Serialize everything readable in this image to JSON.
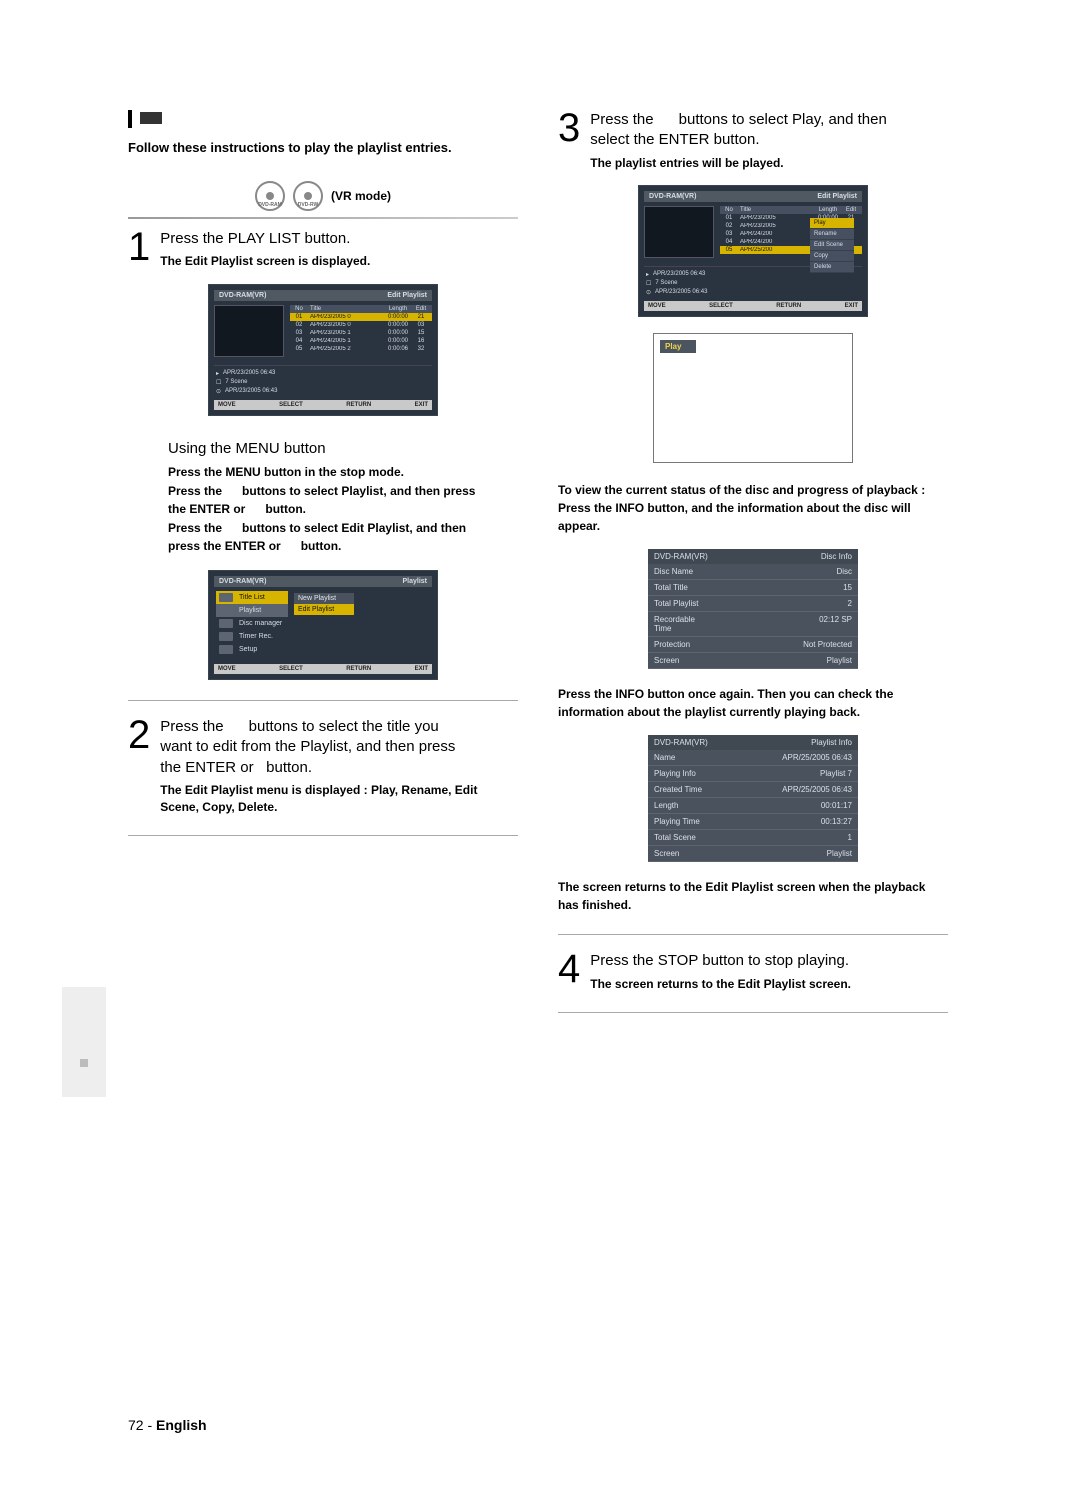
{
  "intro": "Follow these instructions to play the playlist entries.",
  "discs": {
    "d1": "DVD-RAM",
    "d2": "DVD-RW",
    "mode": "(VR mode)"
  },
  "step1": {
    "num": "1",
    "text": "Press the PLAY LIST button.",
    "sub": "The Edit Playlist screen is displayed."
  },
  "screen1": {
    "left": "DVD-RAM(VR)",
    "right": "Edit Playlist",
    "cols": {
      "no": "No",
      "title": "Title",
      "len": "Length",
      "edit": "Edit"
    },
    "rows": [
      {
        "n": "01",
        "t": "APR/23/2005 0",
        "l": "0:00:00",
        "e": "21"
      },
      {
        "n": "02",
        "t": "APR/23/2005 0",
        "l": "0:00:00",
        "e": "03"
      },
      {
        "n": "03",
        "t": "APR/23/2005 1",
        "l": "0:00:00",
        "e": "15"
      },
      {
        "n": "04",
        "t": "APR/24/2005 1",
        "l": "0:00:00",
        "e": "16"
      },
      {
        "n": "05",
        "t": "APR/25/2005 2",
        "l": "0:00:06",
        "e": "32"
      }
    ],
    "info1a": "APR/23/2005 06:43",
    "info1b": "7 Scene",
    "info1c": "APR/23/2005 06:43",
    "ftr": {
      "a": "MOVE",
      "b": "SELECT",
      "c": "RETURN",
      "d": "EXIT"
    }
  },
  "using": "Using the MENU button",
  "using_sub": {
    "l1": "Press the MENU button in the stop mode.",
    "l2a": "Press the",
    "l2b": "buttons to select Playlist, and then press",
    "l3a": "the ENTER or",
    "l3b": "button.",
    "l4a": "Press the",
    "l4b": "buttons to select Edit Playlist, and then",
    "l5a": "press the ENTER or",
    "l5b": "button."
  },
  "menu_screen": {
    "left": "DVD-RAM(VR)",
    "right": "Playlist",
    "items": {
      "title": "Title List",
      "playlist": "Playlist",
      "disc": "Disc manager",
      "timer": "Timer Rec.",
      "setup": "Setup"
    },
    "popup": {
      "a": "New Playlist",
      "b": "Edit Playlist"
    },
    "ftr": {
      "a": "MOVE",
      "b": "SELECT",
      "c": "RETURN",
      "d": "EXIT"
    }
  },
  "step2": {
    "num": "2",
    "text_a": "Press the",
    "text_b": "buttons to select the title you",
    "text_c": "want to edit from the Playlist, and then press",
    "text_d": "the ENTER or",
    "text_e": "button.",
    "sub": "The Edit Playlist menu is displayed : Play, Rename, Edit Scene, Copy, Delete."
  },
  "step3": {
    "num": "3",
    "text_a": "Press the",
    "text_b": "buttons to select Play, and then",
    "text_c": "select the ENTER button.",
    "sub": "The playlist entries will be played."
  },
  "screen3": {
    "left": "DVD-RAM(VR)",
    "right": "Edit Playlist",
    "cols": {
      "no": "No",
      "title": "Title",
      "len": "Length",
      "edit": "Edit"
    },
    "rows": [
      {
        "n": "01",
        "t": "APR/23/2005",
        "l": "0:00:00",
        "e": "21"
      },
      {
        "n": "02",
        "t": "APR/23/2005",
        "l": "0:00:00",
        "e": "02"
      },
      {
        "n": "03",
        "t": "APR/24/200",
        "l": "Play",
        "e": "5"
      },
      {
        "n": "04",
        "t": "APR/24/200",
        "l": "Rename",
        "e": "6"
      },
      {
        "n": "05",
        "t": "APR/25/200",
        "l": "Edit Scene",
        "e": "2"
      }
    ],
    "popup": {
      "a": "Play",
      "b": "Rename",
      "c": "Edit Scene",
      "d": "Copy",
      "e": "Delete"
    },
    "info1a": "APR/23/2005 06:43",
    "info1b": "7 Scene",
    "info1c": "APR/23/2005 06:43",
    "ftr": {
      "a": "MOVE",
      "b": "SELECT",
      "c": "RETURN",
      "d": "EXIT"
    }
  },
  "play_frame": {
    "label": "Play"
  },
  "para_info1": "To view the current status of the disc and progress of playback : Press the INFO button, and the information about the disc will appear.",
  "info_box1": {
    "r0a": "DVD-RAM(VR)",
    "r0b": "Disc Info",
    "r1a": "Disc Name",
    "r1b": "Disc",
    "r2a": "Total Title",
    "r2b": "15",
    "r3a": "Total Playlist",
    "r3b": "2",
    "r4a": "Recordable Time",
    "r4b": "02:12 SP",
    "r5a": "Protection",
    "r5b": "Not Protected",
    "r6a": "Screen",
    "r6b": "Playlist"
  },
  "para_info2": "Press the INFO button once again. Then you can check the information about the playlist currently playing back.",
  "info_box2": {
    "r0a": "DVD-RAM(VR)",
    "r0b": "Playlist Info",
    "r1a": "Name",
    "r1b": "APR/25/2005 06:43",
    "r2a": "Playing Info",
    "r2b": "Playlist 7",
    "r3a": "Created Time",
    "r3b": "APR/25/2005 06:43",
    "r4a": "Length",
    "r4b": "00:01:17",
    "r5a": "Playing Time",
    "r5b": "00:13:27",
    "r6a": "Total Scene",
    "r6b": "1",
    "r7a": "Screen",
    "r7b": "Playlist"
  },
  "para_info3": "The screen returns to the Edit Playlist screen when the playback has finished.",
  "step4": {
    "num": "4",
    "text": "Press the STOP button to stop playing.",
    "sub": "The screen returns to the Edit Playlist screen."
  },
  "footer": {
    "page": "72 -",
    "lang": "English"
  }
}
